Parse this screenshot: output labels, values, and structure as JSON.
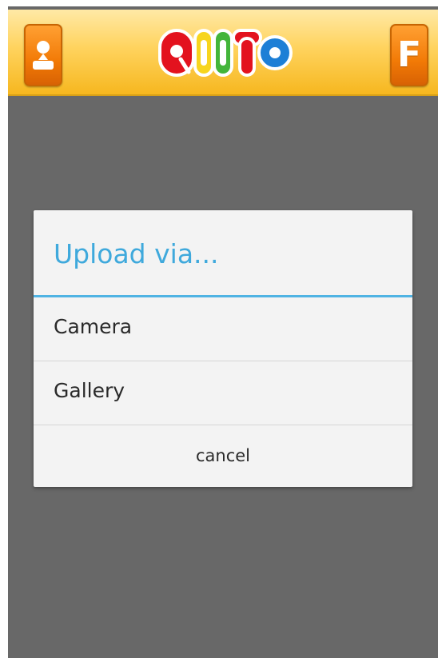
{
  "app": {
    "logo_text": "QIITO"
  },
  "header": {
    "profile_button_icon": "person-icon",
    "facebook_button_label": "F",
    "facebook_button_icon": "facebook-icon"
  },
  "dialog": {
    "title": "Upload via...",
    "options": [
      {
        "label": "Camera"
      },
      {
        "label": "Gallery"
      }
    ],
    "cancel_label": "cancel"
  },
  "colors": {
    "header_accent": "#ffd35e",
    "header_button": "#f27a06",
    "dialog_title": "#3fa9dc",
    "backdrop": "#686868"
  }
}
